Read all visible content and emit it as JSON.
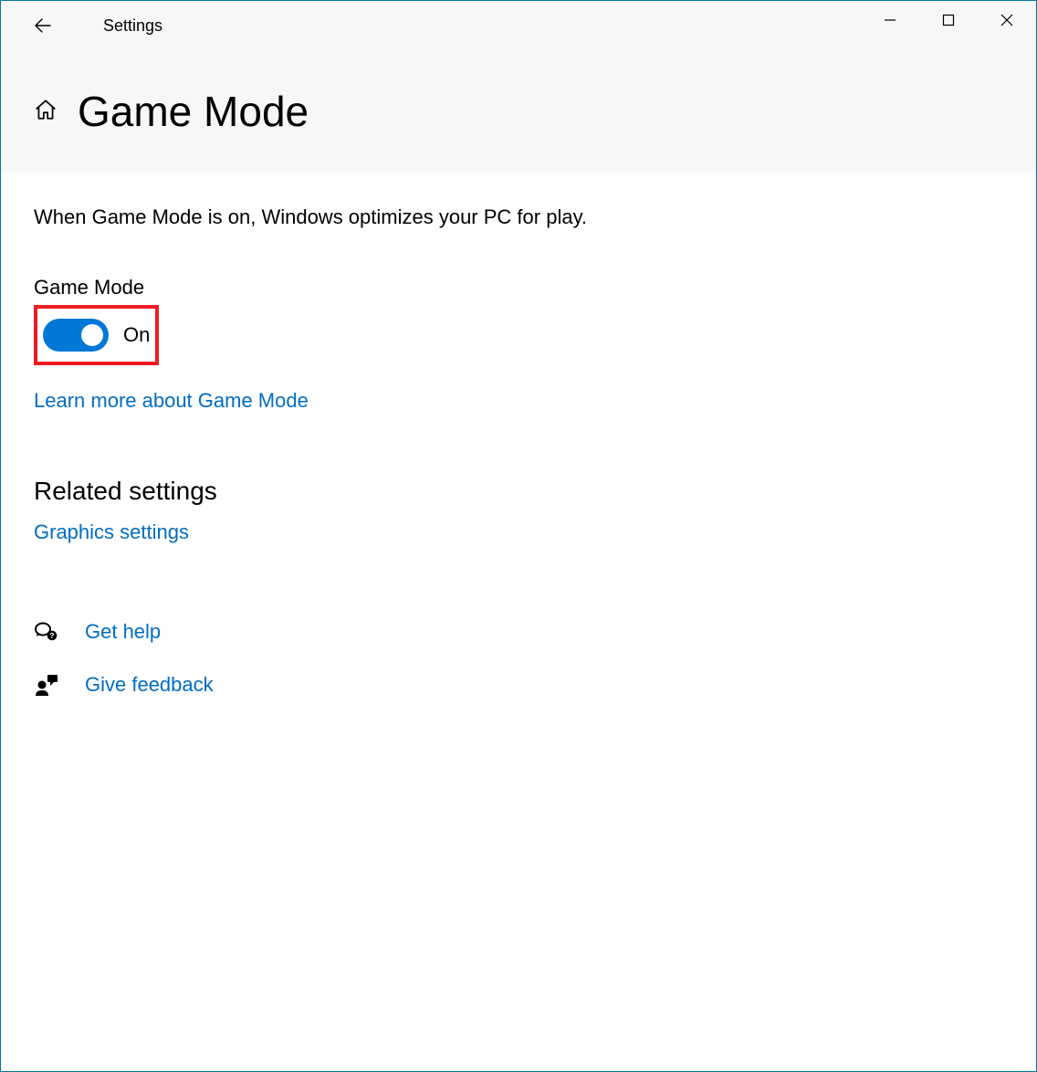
{
  "window": {
    "title": "Settings"
  },
  "page": {
    "title": "Game Mode",
    "description": "When Game Mode is on, Windows optimizes your PC for play."
  },
  "setting": {
    "label": "Game Mode",
    "state_text": "On",
    "toggled_on": true,
    "learn_more": "Learn more about Game Mode"
  },
  "related": {
    "heading": "Related settings",
    "graphics": "Graphics settings"
  },
  "footer": {
    "help": "Get help",
    "feedback": "Give feedback"
  },
  "colors": {
    "accent": "#0078d7",
    "link": "#006dc3",
    "highlight_border": "#ed1c24"
  }
}
